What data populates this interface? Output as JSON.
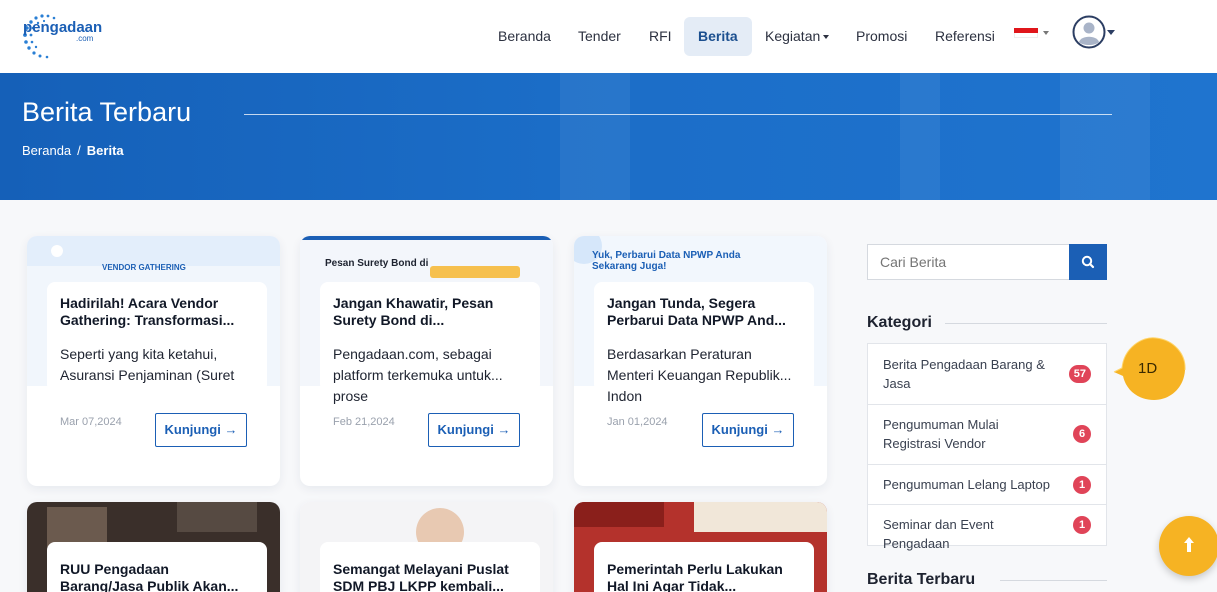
{
  "brand": {
    "name": "pengadaan",
    "suffix": ".com"
  },
  "nav": {
    "items": [
      {
        "label": "Beranda"
      },
      {
        "label": "Tender"
      },
      {
        "label": "RFI"
      },
      {
        "label": "Berita",
        "active": true
      },
      {
        "label": "Kegiatan",
        "dropdown": true
      },
      {
        "label": "Promosi"
      },
      {
        "label": "Referensi"
      }
    ],
    "language_flag": "indonesia-flag-icon",
    "user_icon": "user-avatar-icon"
  },
  "hero": {
    "title": "Berita Terbaru",
    "breadcrumb": [
      {
        "label": "Beranda"
      },
      {
        "label": "Berita"
      }
    ],
    "separator": "/"
  },
  "news": {
    "cards": [
      {
        "image_tag": "VENDOR GATHERING",
        "title": "Hadirilah! Acara Vendor Gathering: Transformasi...",
        "excerpt_lines": [
          "Seperti yang kita ketahui,",
          "Asuransi Penjaminan (Suret"
        ],
        "date": "Mar 07,2024",
        "button": "Kunjungi →"
      },
      {
        "image_tag": "Pesan Surety Bond di",
        "title": "Jangan Khawatir, Pesan Surety Bond di...",
        "excerpt_lines": [
          "Pengadaan.com, sebagai",
          "platform terkemuka untuk...",
          "prose"
        ],
        "date": "Feb 21,2024",
        "button": "Kunjungi →"
      },
      {
        "image_tag": "Yuk, Perbarui Data NPWP Anda Sekarang Juga!",
        "title": "Jangan Tunda, Segera Perbarui Data NPWP And...",
        "excerpt_lines": [
          "Berdasarkan Peraturan",
          "Menteri Keuangan Republik...",
          "Indon"
        ],
        "date": "Jan 01,2024",
        "button": "Kunjungi →"
      },
      {
        "title": "RUU Pengadaan Barang/Jasa Publik Akan..."
      },
      {
        "title": "Semangat Melayani Puslat SDM PBJ LKPP kembali..."
      },
      {
        "title": "Pemerintah Perlu Lakukan Hal Ini Agar Tidak..."
      }
    ]
  },
  "sidebar": {
    "search_placeholder": "Cari Berita",
    "search_icon": "search-icon",
    "categories_title": "Kategori",
    "categories": [
      {
        "label": "Berita Pengadaan Barang & Jasa",
        "count": "57"
      },
      {
        "label": "Pengumuman Mulai Registrasi Vendor",
        "count": "6"
      },
      {
        "label": "Pengumuman Lelang Laptop",
        "count": "1"
      },
      {
        "label": "Seminar dan Event Pengadaan",
        "count": "1"
      }
    ],
    "latest_title": "Berita Terbaru"
  },
  "overlay": {
    "callout_label": "1D"
  },
  "colors": {
    "primary": "#1b5fb5",
    "accent": "#f6b323",
    "badge": "#e04458"
  }
}
